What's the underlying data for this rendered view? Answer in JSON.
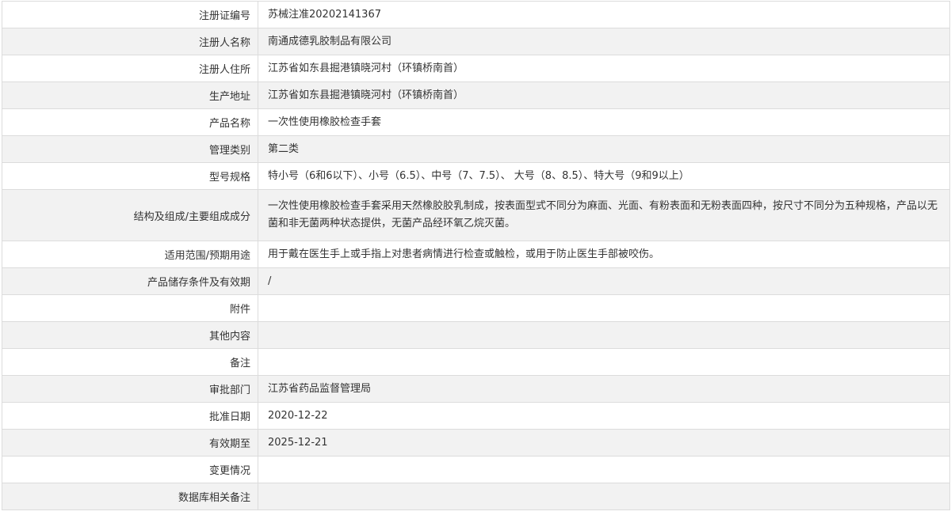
{
  "rows": [
    {
      "label": "注册证编号",
      "value": "苏械注准20202141367"
    },
    {
      "label": "注册人名称",
      "value": "南通成德乳胶制品有限公司"
    },
    {
      "label": "注册人住所",
      "value": "江苏省如东县掘港镇晓河村（环镇桥南首）"
    },
    {
      "label": "生产地址",
      "value": "江苏省如东县掘港镇晓河村（环镇桥南首）"
    },
    {
      "label": "产品名称",
      "value": "一次性使用橡胶检查手套"
    },
    {
      "label": "管理类别",
      "value": "第二类"
    },
    {
      "label": "型号规格",
      "value": "特小号（6和6以下）、小号（6.5）、中号（7、7.5）、 大号（8、8.5）、特大号（9和9以上）"
    },
    {
      "label": "结构及组成/主要组成成分",
      "value": "一次性使用橡胶检查手套采用天然橡胶胶乳制成，按表面型式不同分为麻面、光面、有粉表面和无粉表面四种，按尺寸不同分为五种规格，产品以无菌和非无菌两种状态提供，无菌产品经环氧乙烷灭菌。"
    },
    {
      "label": "适用范围/预期用途",
      "value": "用于戴在医生手上或手指上对患者病情进行检查或触检，或用于防止医生手部被咬伤。"
    },
    {
      "label": "产品储存条件及有效期",
      "value": "/"
    },
    {
      "label": "附件",
      "value": ""
    },
    {
      "label": "其他内容",
      "value": ""
    },
    {
      "label": "备注",
      "value": ""
    },
    {
      "label": "审批部门",
      "value": "江苏省药品监督管理局"
    },
    {
      "label": "批准日期",
      "value": "2020-12-22"
    },
    {
      "label": "有效期至",
      "value": "2025-12-21"
    },
    {
      "label": "变更情况",
      "value": ""
    },
    {
      "label": "数据库相关备注",
      "value": ""
    }
  ]
}
